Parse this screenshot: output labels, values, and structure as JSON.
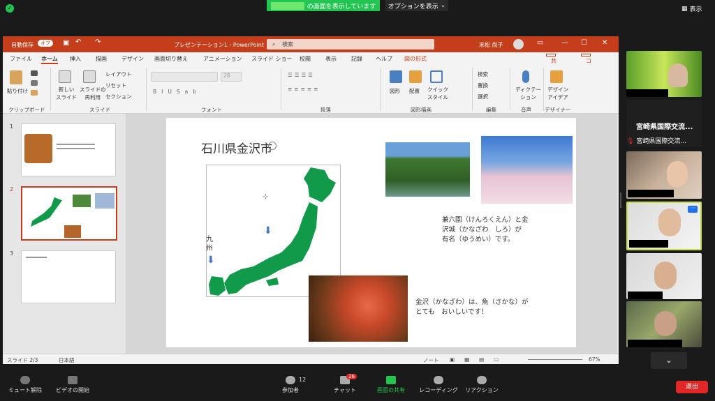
{
  "zoom": {
    "share_banner": "の画面を表示しています",
    "view_options": "オプションを表示",
    "view_button": "表示",
    "shield_glyph": "✓",
    "toolbar": {
      "mute": "ミュート解除",
      "video": "ビデオの開始",
      "participants": "参加者",
      "participants_count": "12",
      "chat": "チャット",
      "chat_badge": "26",
      "share": "画面の共有",
      "record": "レコーディング",
      "reactions": "リアクション",
      "end": "退出"
    },
    "participants_panel": {
      "name_1": "宮崎県国際交流...",
      "name_2": "宮崎県国際交流..."
    }
  },
  "ppt": {
    "title": {
      "autosave": "自動保存",
      "autosave_state": "オフ",
      "doc": "プレゼンテーション1 - PowerPoint",
      "search": "検索",
      "user": "末松 尚子"
    },
    "menu": [
      "ファイル",
      "ホーム",
      "挿入",
      "描画",
      "デザイン",
      "画面切り替え",
      "アニメーション",
      "スライド ショー",
      "校閲",
      "表示",
      "記録",
      "ヘルプ",
      "図の形式"
    ],
    "menu_share": "共有",
    "menu_comment": "コメント",
    "ribbon": {
      "paste": "貼り付け",
      "new_slide": "新しい\nスライド",
      "reuse": "スライドの\n再利用",
      "layout": "レイアウト",
      "reset": "リセット",
      "section": "セクション",
      "font_size": "28",
      "shapes": "図形",
      "arrange": "配置",
      "quick_style": "クイック\nスタイル",
      "find": "検索",
      "replace": "置換",
      "select": "選択",
      "dictate": "ディクテー\nション",
      "designer": "デザイン\nアイデア",
      "groups": {
        "clipboard": "クリップボード",
        "slides": "スライド",
        "font": "フォント",
        "paragraph": "段落",
        "drawing": "図形描画",
        "editing": "編集",
        "voice": "音声",
        "designer": "デザイナー"
      }
    },
    "thumbs": [
      "1",
      "2",
      "3"
    ],
    "slide": {
      "title": "石川県金沢市",
      "kyushu": "九\n州",
      "text1": "兼六園（けんろくえん）と金\n沢城（かなざわ　しろ）が\n有名（ゆうめい）です。",
      "text2": "金沢（かなざわ）は、魚（さかな）が\nとても　おいしいです！"
    },
    "status": {
      "slide": "スライド 2/3",
      "lang": "日本語",
      "notes": "ノート",
      "zoom": "67%"
    }
  },
  "colors": {
    "ppt_red": "#c43e1c",
    "zoom_green": "#23c552",
    "map_green": "#119a4a",
    "end_red": "#e02828"
  }
}
